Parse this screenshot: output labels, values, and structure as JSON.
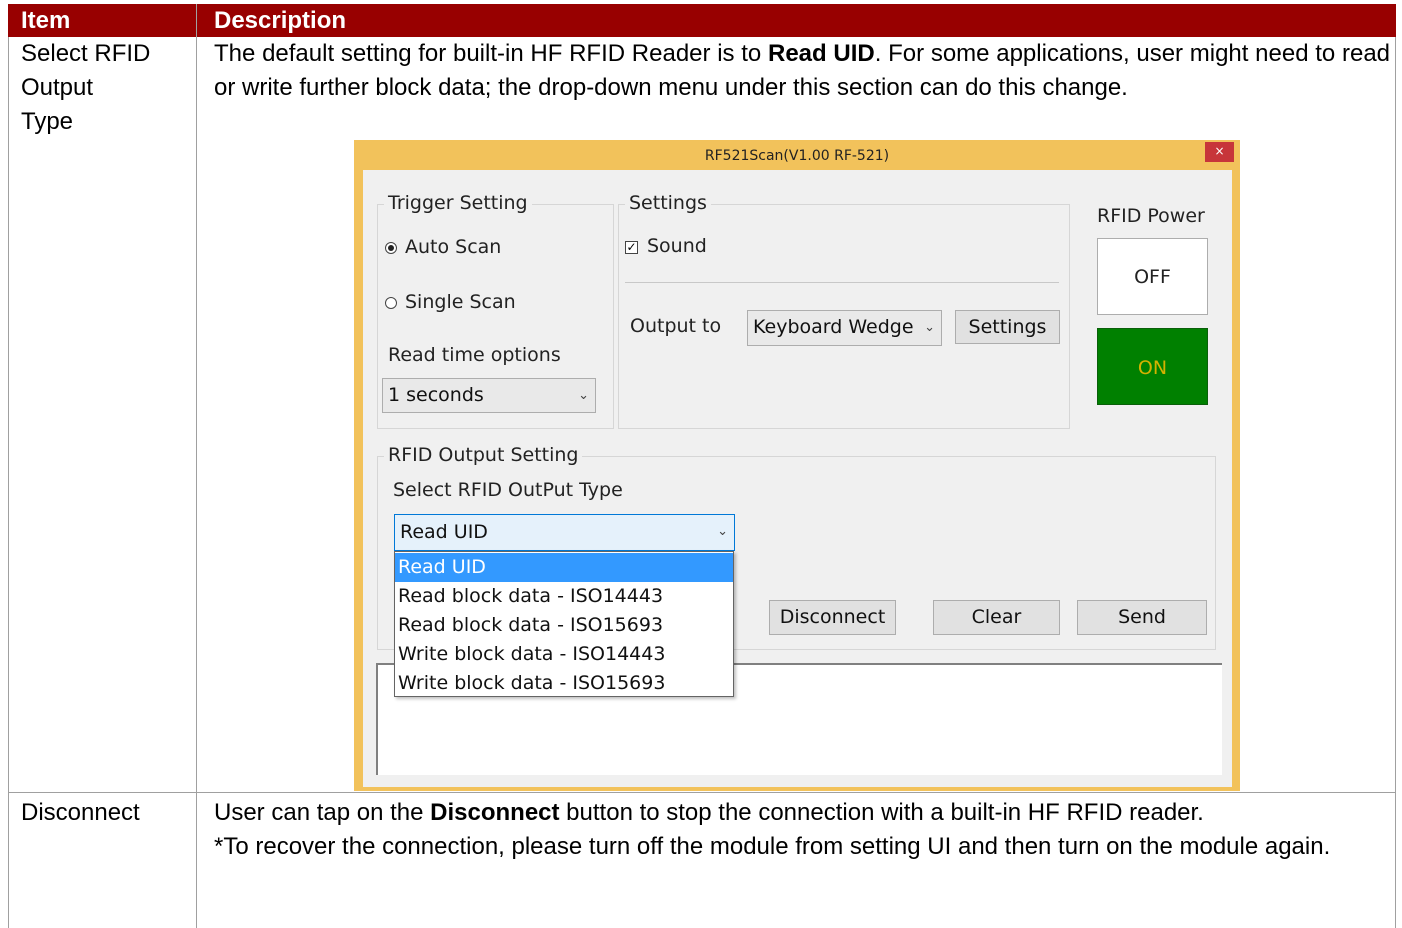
{
  "table": {
    "header": {
      "item": "Item",
      "description": "Description"
    },
    "rows": [
      {
        "item": [
          "Select RFID",
          "Output",
          "Type"
        ],
        "description": {
          "line1_pre": "The default setting for built-in HF RFID Reader is to ",
          "line1_bold": "Read UID",
          "line1_post": ". For some applications, user might need to read or write further block data; the drop-down menu under this section can do this change."
        }
      },
      {
        "item": [
          "Disconnect"
        ],
        "description": {
          "line1_pre": "User can tap on the ",
          "line1_bold": "Disconnect",
          "line1_post": " button to stop the connection with a built-in HF RFID reader.",
          "line2": "*To recover the connection, please turn off the module from setting UI and then turn on the module again."
        }
      }
    ]
  },
  "window": {
    "title": "RF521Scan(V1.00 RF-521)",
    "close_glyph": "×",
    "trigger": {
      "label": "Trigger Setting",
      "auto_scan": "Auto Scan",
      "single_scan": "Single Scan",
      "auto_scan_selected": true,
      "read_time_label": "Read time options",
      "read_time_value": "1 seconds"
    },
    "settings": {
      "label": "Settings",
      "sound": "Sound",
      "sound_checked": true,
      "output_to_label": "Output to",
      "output_to_value": "Keyboard Wedge",
      "settings_button": "Settings"
    },
    "power": {
      "label": "RFID Power",
      "off": "OFF",
      "on": "ON",
      "on_color": "#008000"
    },
    "output": {
      "label": "RFID Output Setting",
      "type_label": "Select RFID OutPut Type",
      "type_value": "Read UID",
      "options": [
        "Read UID",
        "Read block data - ISO14443",
        "Read block data - ISO15693",
        "Write block data - ISO14443",
        "Write block data - ISO15693"
      ],
      "selected_index": 0
    },
    "buttons": {
      "disconnect": "Disconnect",
      "clear": "Clear",
      "send": "Send"
    }
  },
  "colors": {
    "header_bg": "#980000",
    "window_frame": "#f2c25b",
    "highlight": "#3399ff"
  },
  "icons": {
    "close": "close-icon",
    "chevron": "chevron-down-icon"
  }
}
